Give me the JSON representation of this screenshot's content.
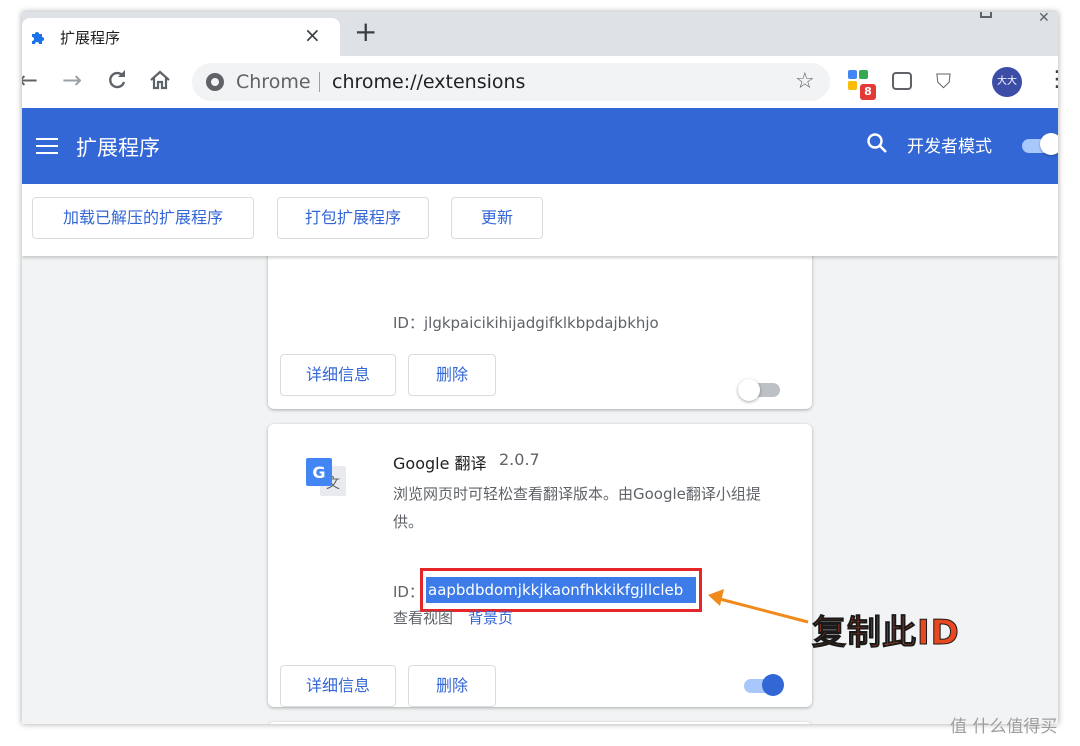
{
  "browser": {
    "tab_title": "扩展程序",
    "tab_close": "×",
    "new_tab": "+",
    "omnibox_brand": "Chrome",
    "omnibox_url": "chrome://extensions",
    "avatar_text": "大大",
    "extension_badge": "8"
  },
  "header": {
    "title": "扩展程序",
    "dev_mode_label": "开发者模式",
    "dev_mode_on": true
  },
  "actions": {
    "load_unpacked": "加载已解压的扩展程序",
    "pack": "打包扩展程序",
    "update": "更新"
  },
  "cards": [
    {
      "id_label": "ID：",
      "id": "jlgkpaicikihijadgifklkbpdajbkhjo",
      "details": "详细信息",
      "remove": "删除",
      "enabled": false
    },
    {
      "name": "Google 翻译",
      "version": "2.0.7",
      "description": "浏览网页时可轻松查看翻译版本。由Google翻译小组提供。",
      "id_label": "ID：",
      "id": "aapbdbdomjkkjkaonfhkkikfgjllcleb",
      "view_label": "查看视图",
      "view_link": "背景页",
      "details": "详细信息",
      "remove": "删除",
      "enabled": true
    }
  ],
  "annotation": {
    "callout": "复制此ID",
    "color": "#e8481f"
  },
  "watermark": "值 什么值得买",
  "colors": {
    "header_blue": "#3367d6",
    "highlight_red": "#e4262b",
    "selection_blue": "#3d7be8"
  }
}
